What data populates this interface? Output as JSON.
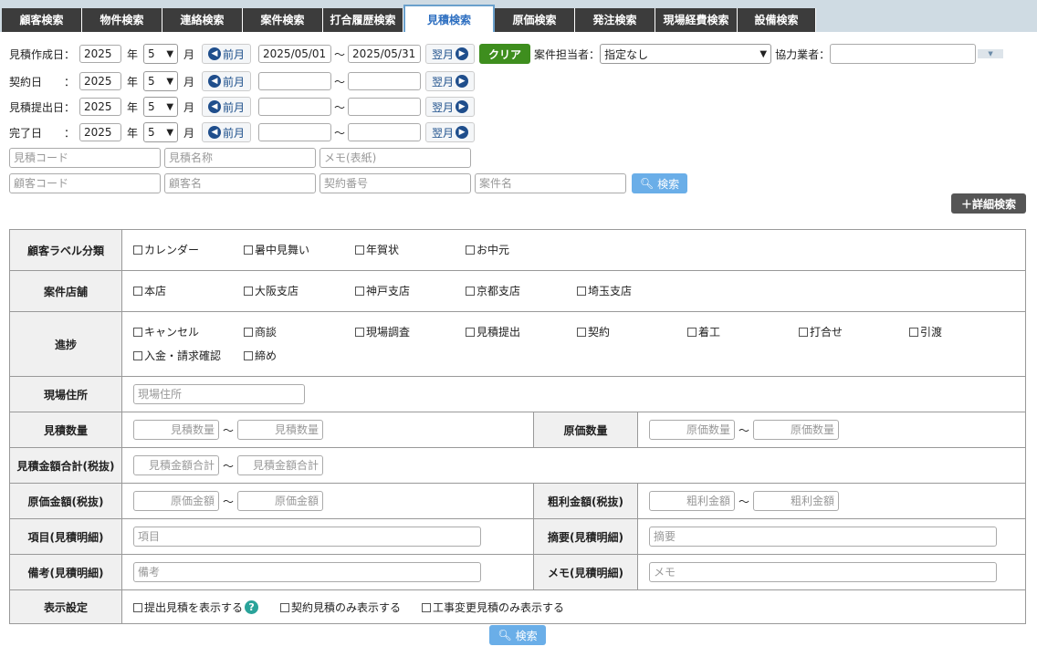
{
  "tabs": [
    {
      "label": "顧客検索"
    },
    {
      "label": "物件検索"
    },
    {
      "label": "連絡検索"
    },
    {
      "label": "案件検索"
    },
    {
      "label": "打合履歴検索"
    },
    {
      "label": "見積検索"
    },
    {
      "label": "原価検索"
    },
    {
      "label": "発注検索"
    },
    {
      "label": "現場経費検索"
    },
    {
      "label": "設備検索"
    }
  ],
  "date_rows": [
    {
      "label": "見積作成日：",
      "year": "2025",
      "month": "5",
      "from": "2025/05/01",
      "to": "2025/05/31"
    },
    {
      "label": "契約日　　：",
      "year": "2025",
      "month": "5",
      "from": "",
      "to": ""
    },
    {
      "label": "見積提出日：",
      "year": "2025",
      "month": "5",
      "from": "",
      "to": ""
    },
    {
      "label": "完了日　　：",
      "year": "2025",
      "month": "5",
      "from": "",
      "to": ""
    }
  ],
  "common": {
    "year_unit": "年",
    "month_unit": "月",
    "prev": "前月",
    "next": "翌月",
    "tilde": "～"
  },
  "clear_label": "クリア",
  "staff_label": "案件担当者：",
  "staff_value": "指定なし",
  "partner_label": "協力業者：",
  "partner_value": "",
  "fields1": {
    "p1": "見積コード",
    "p2": "見積名称",
    "p3": "メモ(表紙)"
  },
  "fields2": {
    "p1": "顧客コード",
    "p2": "顧客名",
    "p3": "契約番号",
    "p4": "案件名"
  },
  "search_label": "検索",
  "detail_label": "＋詳細検索",
  "grid": {
    "customer_label": {
      "head": "顧客ラベル分類",
      "items": [
        "カレンダー",
        "暑中見舞い",
        "年賀状",
        "お中元"
      ]
    },
    "store": {
      "head": "案件店舗",
      "items": [
        "本店",
        "大阪支店",
        "神戸支店",
        "京都支店",
        "埼玉支店"
      ]
    },
    "progress": {
      "head": "進捗",
      "items": [
        "キャンセル",
        "商談",
        "現場調査",
        "見積提出",
        "契約",
        "着工",
        "打合せ",
        "引渡"
      ],
      "items2": [
        "入金・請求確認",
        "締め"
      ]
    },
    "site_address": {
      "head": "現場住所",
      "ph": "現場住所"
    },
    "est_qty": {
      "head": "見積数量",
      "ph": "見積数量"
    },
    "cost_qty": {
      "head": "原価数量",
      "ph": "原価数量"
    },
    "est_total": {
      "head": "見積金額合計(税抜)",
      "ph": "見積金額合計"
    },
    "cost_amount": {
      "head": "原価金額(税抜)",
      "ph": "原価金額"
    },
    "gross_amount": {
      "head": "粗利金額(税抜)",
      "ph": "粗利金額"
    },
    "item": {
      "head": "項目(見積明細)",
      "ph": "項目"
    },
    "summary": {
      "head": "摘要(見積明細)",
      "ph": "摘要"
    },
    "remarks": {
      "head": "備考(見積明細)",
      "ph": "備考"
    },
    "memo": {
      "head": "メモ(見積明細)",
      "ph": "メモ"
    },
    "display": {
      "head": "表示設定",
      "opt1": "提出見積を表示する",
      "opt2": "契約見積のみ表示する",
      "opt3": "工事変更見積のみ表示する"
    }
  },
  "colors": {
    "active_tab": "#2c6ec0",
    "clear": "#3e8e1e",
    "search": "#6aaee8",
    "help": "#2aa39a"
  }
}
